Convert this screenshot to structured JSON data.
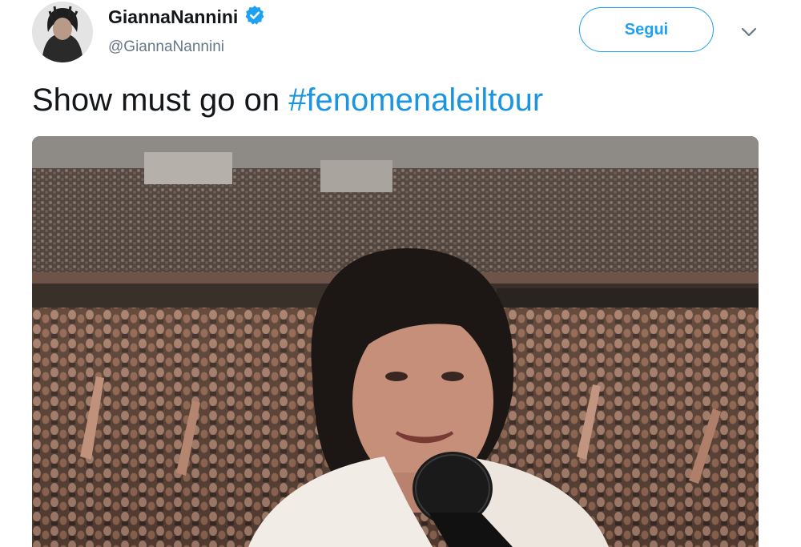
{
  "user": {
    "display_name": "GiannaNannini",
    "handle": "@GiannaNannini",
    "verified": true,
    "avatar_icon": "profile-photo",
    "verified_icon": "verified-badge-icon"
  },
  "actions": {
    "follow_label": "Segui",
    "more_icon": "chevron-down-icon"
  },
  "tweet": {
    "text_plain": "Show must go on ",
    "hashtag": "#fenomenaleiltour"
  },
  "media": {
    "icon": "concert-selfie-video-frame"
  },
  "colors": {
    "accent": "#1da1f2",
    "hashtag": "#1b95e0",
    "name": "#14171a",
    "secondary": "#657786"
  }
}
